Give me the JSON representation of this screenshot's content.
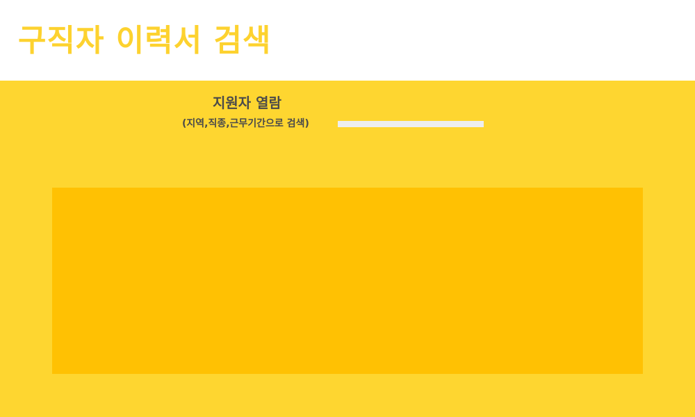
{
  "header": {
    "title": "구직자 이력서 검색"
  },
  "main": {
    "section_title": "지원자 열람",
    "search": {
      "hint": "(지역,직종,근무기간으로 검색)",
      "value": "",
      "placeholder": ""
    },
    "results": {
      "items": []
    }
  },
  "colors": {
    "title_yellow": "#fdd22f",
    "background_yellow": "#fed630",
    "panel_amber": "#ffc103",
    "text_dark": "#4a4a4a",
    "input_bg": "#eeeeee"
  }
}
